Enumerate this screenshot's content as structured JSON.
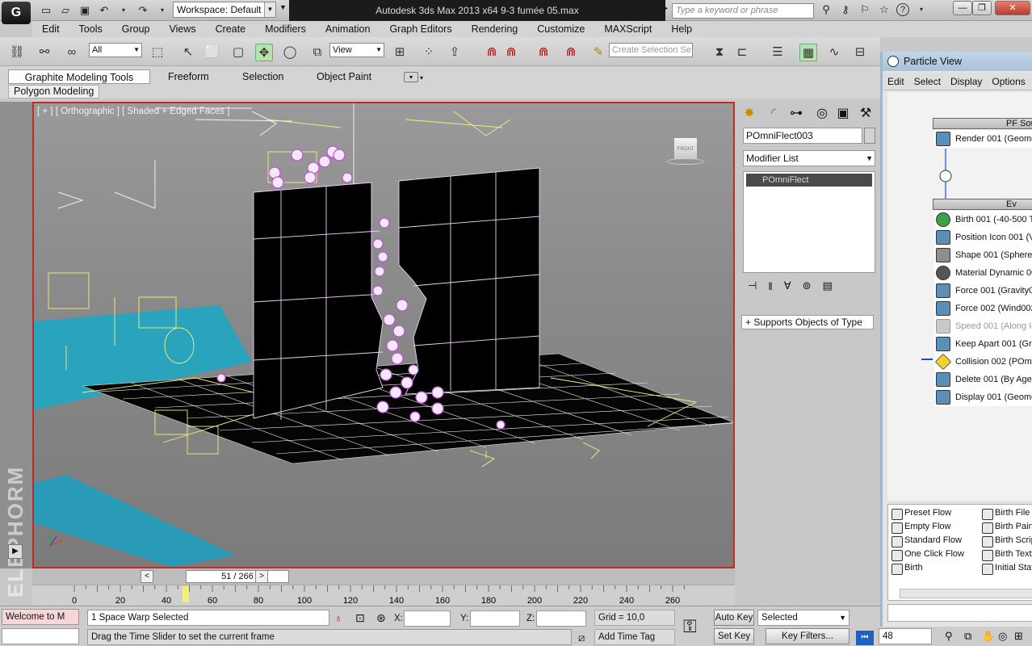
{
  "app": {
    "logo_text": "G",
    "workspace": "Workspace: Default",
    "window_title": "Autodesk 3ds Max  2013 x64      9-3 fumée 05.max",
    "search_placeholder": "Type a keyword or phrase"
  },
  "menu": [
    "Edit",
    "Tools",
    "Group",
    "Views",
    "Create",
    "Modifiers",
    "Animation",
    "Graph Editors",
    "Rendering",
    "Customize",
    "MAXScript",
    "Help"
  ],
  "toolbar": {
    "selection_filter": "All",
    "ref_coord": "View",
    "named_selection_placeholder": "Create Selection Se"
  },
  "ribbon": {
    "tabs": [
      "Graphite Modeling Tools",
      "Freeform",
      "Selection",
      "Object Paint"
    ],
    "panel": "Polygon Modeling"
  },
  "viewport": {
    "label": "[ + ] [ Orthographic ] [ Shaded + Edged Faces ]",
    "viewcube_face": "FRONT"
  },
  "command_panel": {
    "object_name": "POmniFlect003",
    "modifier_list": "Modifier List",
    "stack_item": "POmniFlect",
    "rollout": "Supports Objects of Type"
  },
  "particle_view": {
    "title": "Particle View",
    "menu": [
      "Edit",
      "Select",
      "Display",
      "Options"
    ],
    "source_header": "PF Sou",
    "source_rows": [
      {
        "label": "Render 001 (Geome",
        "color": "#5a8fb8"
      }
    ],
    "event_header": "Ev",
    "event_rows": [
      {
        "label": "Birth 001 (-40-500 T",
        "color": "#3fa04a"
      },
      {
        "label": "Position Icon 001 (Vo",
        "color": "#5a8fb8"
      },
      {
        "label": "Shape 001 (Sphere",
        "color": "#8e8e8e"
      },
      {
        "label": "Material Dynamic 00",
        "color": "#555555"
      },
      {
        "label": "Force 001 (Gravity0",
        "color": "#5a8fb8"
      },
      {
        "label": "Force 002 (Wind002",
        "color": "#5a8fb8"
      },
      {
        "label": "Speed 001 (Along Ic",
        "color": "#c9c9c9"
      },
      {
        "label": "Keep Apart 001 (Gro",
        "color": "#5a8fb8"
      },
      {
        "label": "Collision 002 (POmni",
        "color": "#f2d22e"
      },
      {
        "label": "Delete 001 (By Age",
        "color": "#5a8fb8"
      },
      {
        "label": "Display 001 (Geome",
        "color": "#5a8fb8"
      }
    ],
    "depot_left": [
      "Preset Flow",
      "Empty Flow",
      "Standard Flow",
      "One Click Flow",
      "Birth"
    ],
    "depot_right": [
      "Birth File",
      "Birth Paint",
      "Birth Scrip",
      "Birth Textu",
      "Initial Stat"
    ]
  },
  "timeline": {
    "frame_display": "51 / 266",
    "current_frame": 51,
    "total_frames": 266,
    "ticks": [
      "0",
      "20",
      "40",
      "60",
      "80",
      "100",
      "120",
      "140",
      "160",
      "180",
      "200",
      "220",
      "240",
      "260"
    ]
  },
  "status": {
    "maxscript_listener": "Welcome to M",
    "selection_info": "1 Space Warp Selected",
    "prompt": "Drag the Time Slider to set the current frame",
    "x_label": "X:",
    "y_label": "Y:",
    "z_label": "Z:",
    "grid": "Grid = 10,0",
    "add_time_tag": "Add Time Tag",
    "auto_key": "Auto Key",
    "set_key": "Set Key",
    "key_mode": "Selected",
    "key_filters": "Key Filters...",
    "frame_field": "48"
  },
  "watermark": "ELEPHORM",
  "colors": {
    "viewport_border": "#c62828",
    "particles": "#d070e0",
    "wireframe": "#f4ef7a",
    "cyan": "#19a9c6"
  }
}
